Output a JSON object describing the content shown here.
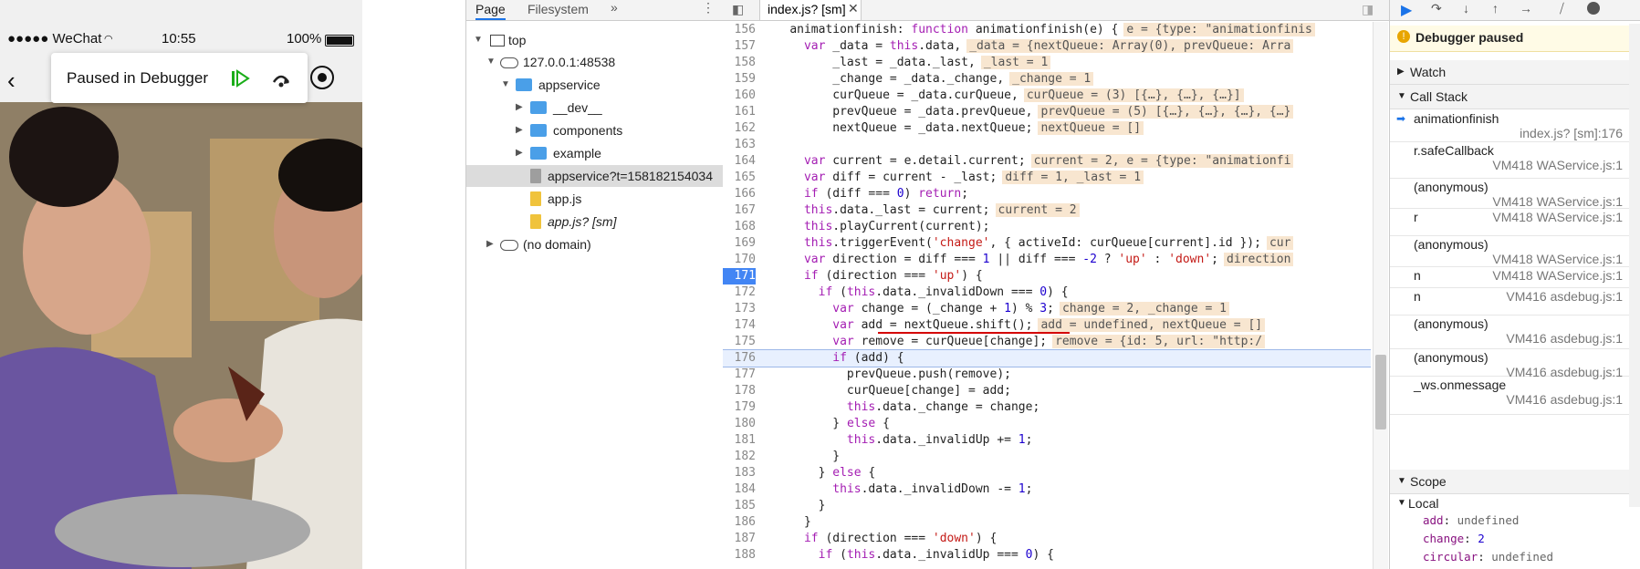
{
  "phone": {
    "carrier": "●●●●● WeChat",
    "time": "10:55",
    "battery": "100%",
    "toast_text": "Paused in Debugger"
  },
  "navigator": {
    "tabs": [
      "Page",
      "Filesystem"
    ],
    "more": "»",
    "tree": [
      {
        "label": "top"
      },
      {
        "label": "127.0.0.1:48538"
      },
      {
        "label": "appservice"
      },
      {
        "label": "__dev__"
      },
      {
        "label": "components"
      },
      {
        "label": "example"
      },
      {
        "label": "appservice?t=158182154034"
      },
      {
        "label": "app.js"
      },
      {
        "label": "app.js? [sm]"
      },
      {
        "label": "(no domain)"
      }
    ]
  },
  "editor": {
    "tab_label": "index.js? [sm]",
    "current_line": "171",
    "lines": [
      {
        "n": "156",
        "code": "    animationfinish: function animationfinish(e) {",
        "val": "e = {type: \"animationfinis"
      },
      {
        "n": "157",
        "code": "      var _data = this.data,",
        "val": "_data = {nextQueue: Array(0), prevQueue: Arra"
      },
      {
        "n": "158",
        "code": "          _last = _data._last,",
        "val": "_last = 1"
      },
      {
        "n": "159",
        "code": "          _change = _data._change,",
        "val": "_change = 1"
      },
      {
        "n": "160",
        "code": "          curQueue = _data.curQueue,",
        "val": "curQueue = (3) [{…}, {…}, {…}]"
      },
      {
        "n": "161",
        "code": "          prevQueue = _data.prevQueue,",
        "val": "prevQueue = (5) [{…}, {…}, {…}, {…}"
      },
      {
        "n": "162",
        "code": "          nextQueue = _data.nextQueue;",
        "val": "nextQueue = []"
      },
      {
        "n": "163",
        "code": "",
        "val": ""
      },
      {
        "n": "164",
        "code": "      var current = e.detail.current;",
        "val": "current = 2, e = {type: \"animationfi"
      },
      {
        "n": "165",
        "code": "      var diff = current - _last;",
        "val": "diff = 1, _last = 1"
      },
      {
        "n": "166",
        "code": "      if (diff === 0) return;",
        "val": ""
      },
      {
        "n": "167",
        "code": "      this.data._last = current;",
        "val": "current = 2"
      },
      {
        "n": "168",
        "code": "      this.playCurrent(current);",
        "val": ""
      },
      {
        "n": "169",
        "code": "      this.triggerEvent('change', { activeId: curQueue[current].id });",
        "val": "cur"
      },
      {
        "n": "170",
        "code": "      var direction = diff === 1 || diff === -2 ? 'up' : 'down';",
        "val": "direction"
      },
      {
        "n": "171",
        "code": "      if (direction === 'up') {",
        "val": ""
      },
      {
        "n": "172",
        "code": "        if (this.data._invalidDown === 0) {",
        "val": ""
      },
      {
        "n": "173",
        "code": "          var change = (_change + 1) % 3;",
        "val": "change = 2, _change = 1"
      },
      {
        "n": "174",
        "code": "          var add = nextQueue.shift();",
        "val": "add = undefined, nextQueue = []"
      },
      {
        "n": "175",
        "code": "          var remove = curQueue[change];",
        "val": "remove = {id: 5, url: \"http:/"
      },
      {
        "n": "176",
        "code": "          if (add) {",
        "val": ""
      },
      {
        "n": "177",
        "code": "            prevQueue.push(remove);",
        "val": ""
      },
      {
        "n": "178",
        "code": "            curQueue[change] = add;",
        "val": ""
      },
      {
        "n": "179",
        "code": "            this.data._change = change;",
        "val": ""
      },
      {
        "n": "180",
        "code": "          } else {",
        "val": ""
      },
      {
        "n": "181",
        "code": "            this.data._invalidUp += 1;",
        "val": ""
      },
      {
        "n": "182",
        "code": "          }",
        "val": ""
      },
      {
        "n": "183",
        "code": "        } else {",
        "val": ""
      },
      {
        "n": "184",
        "code": "          this.data._invalidDown -= 1;",
        "val": ""
      },
      {
        "n": "185",
        "code": "        }",
        "val": ""
      },
      {
        "n": "186",
        "code": "      }",
        "val": ""
      },
      {
        "n": "187",
        "code": "      if (direction === 'down') {",
        "val": ""
      },
      {
        "n": "188",
        "code": "        if (this.data._invalidUp === 0) {",
        "val": ""
      }
    ]
  },
  "debugger": {
    "status": "Debugger paused",
    "watch": "Watch",
    "call_stack": "Call Stack",
    "frames": [
      {
        "name": "animationfinish",
        "loc": "index.js? [sm]:176"
      },
      {
        "name": "r.safeCallback",
        "loc": "VM418 WAService.js:1"
      },
      {
        "name": "(anonymous)",
        "loc": "VM418 WAService.js:1"
      },
      {
        "name": "r",
        "loc": "VM418 WAService.js:1"
      },
      {
        "name": "(anonymous)",
        "loc": "VM418 WAService.js:1"
      },
      {
        "name": "n",
        "loc": "VM418 WAService.js:1"
      },
      {
        "name": "n",
        "loc": "VM416 asdebug.js:1"
      },
      {
        "name": "(anonymous)",
        "loc": "VM416 asdebug.js:1"
      },
      {
        "name": "(anonymous)",
        "loc": "VM416 asdebug.js:1"
      },
      {
        "name": "_ws.onmessage",
        "loc": "VM416 asdebug.js:1"
      }
    ],
    "scope": "Scope",
    "local": "Local",
    "locals": [
      {
        "k": "add",
        "v": "undefined"
      },
      {
        "k": "change",
        "v": "2"
      },
      {
        "k": "circular",
        "v": "undefined"
      }
    ]
  },
  "colors": {
    "accent": "#1a73e8",
    "paused_bg": "#fffbe6"
  }
}
